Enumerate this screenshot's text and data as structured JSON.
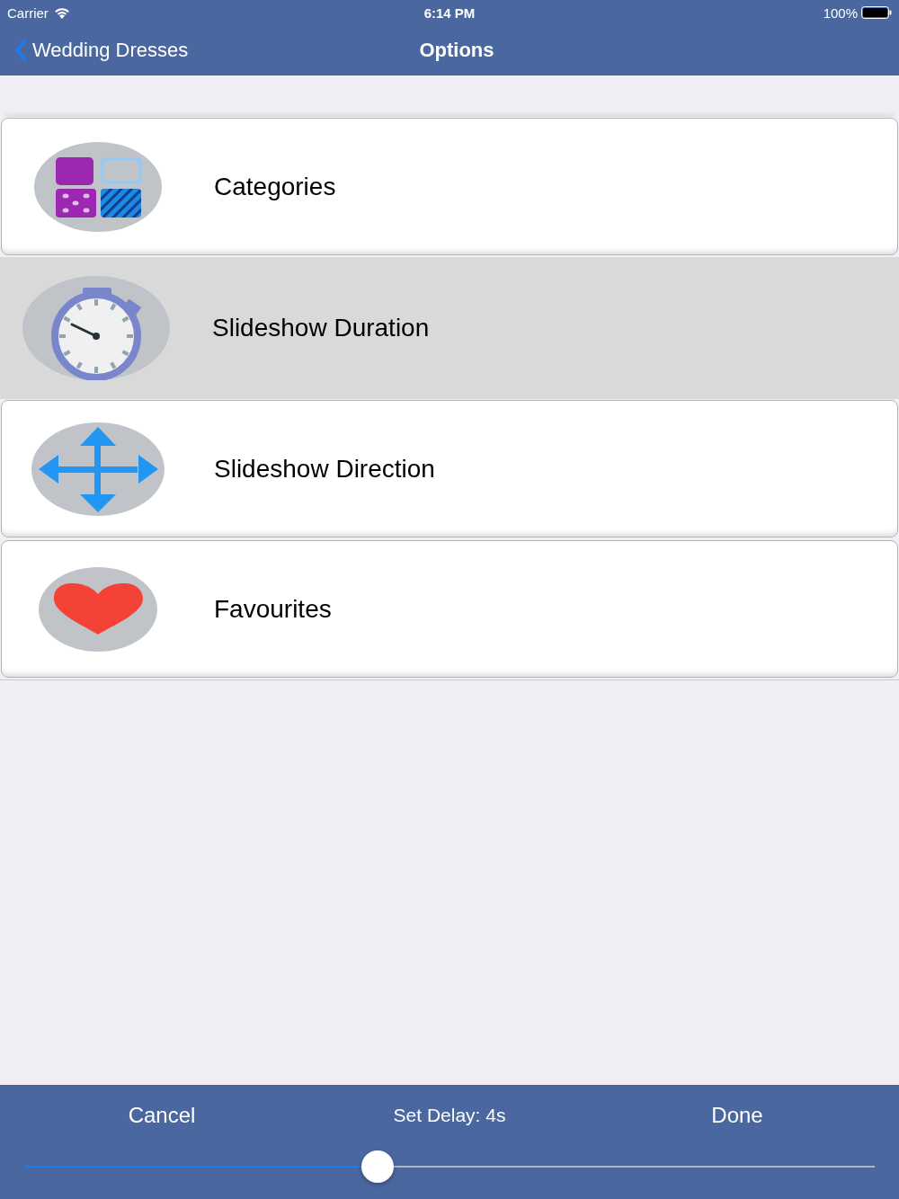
{
  "status_bar": {
    "carrier": "Carrier",
    "time": "6:14 PM",
    "battery": "100%"
  },
  "nav_bar": {
    "back_label": "Wedding Dresses",
    "title": "Options"
  },
  "options": [
    {
      "label": "Categories",
      "kind": "grid",
      "selected": false
    },
    {
      "label": "Slideshow Duration",
      "kind": "stopwatch",
      "selected": true
    },
    {
      "label": "Slideshow Direction",
      "kind": "arrows",
      "selected": false
    },
    {
      "label": "Favourites",
      "kind": "heart",
      "selected": false
    }
  ],
  "toolbar": {
    "cancel": "Cancel",
    "caption": "Set Delay: 4s",
    "done": "Done",
    "slider": {
      "level": 0.415
    }
  }
}
